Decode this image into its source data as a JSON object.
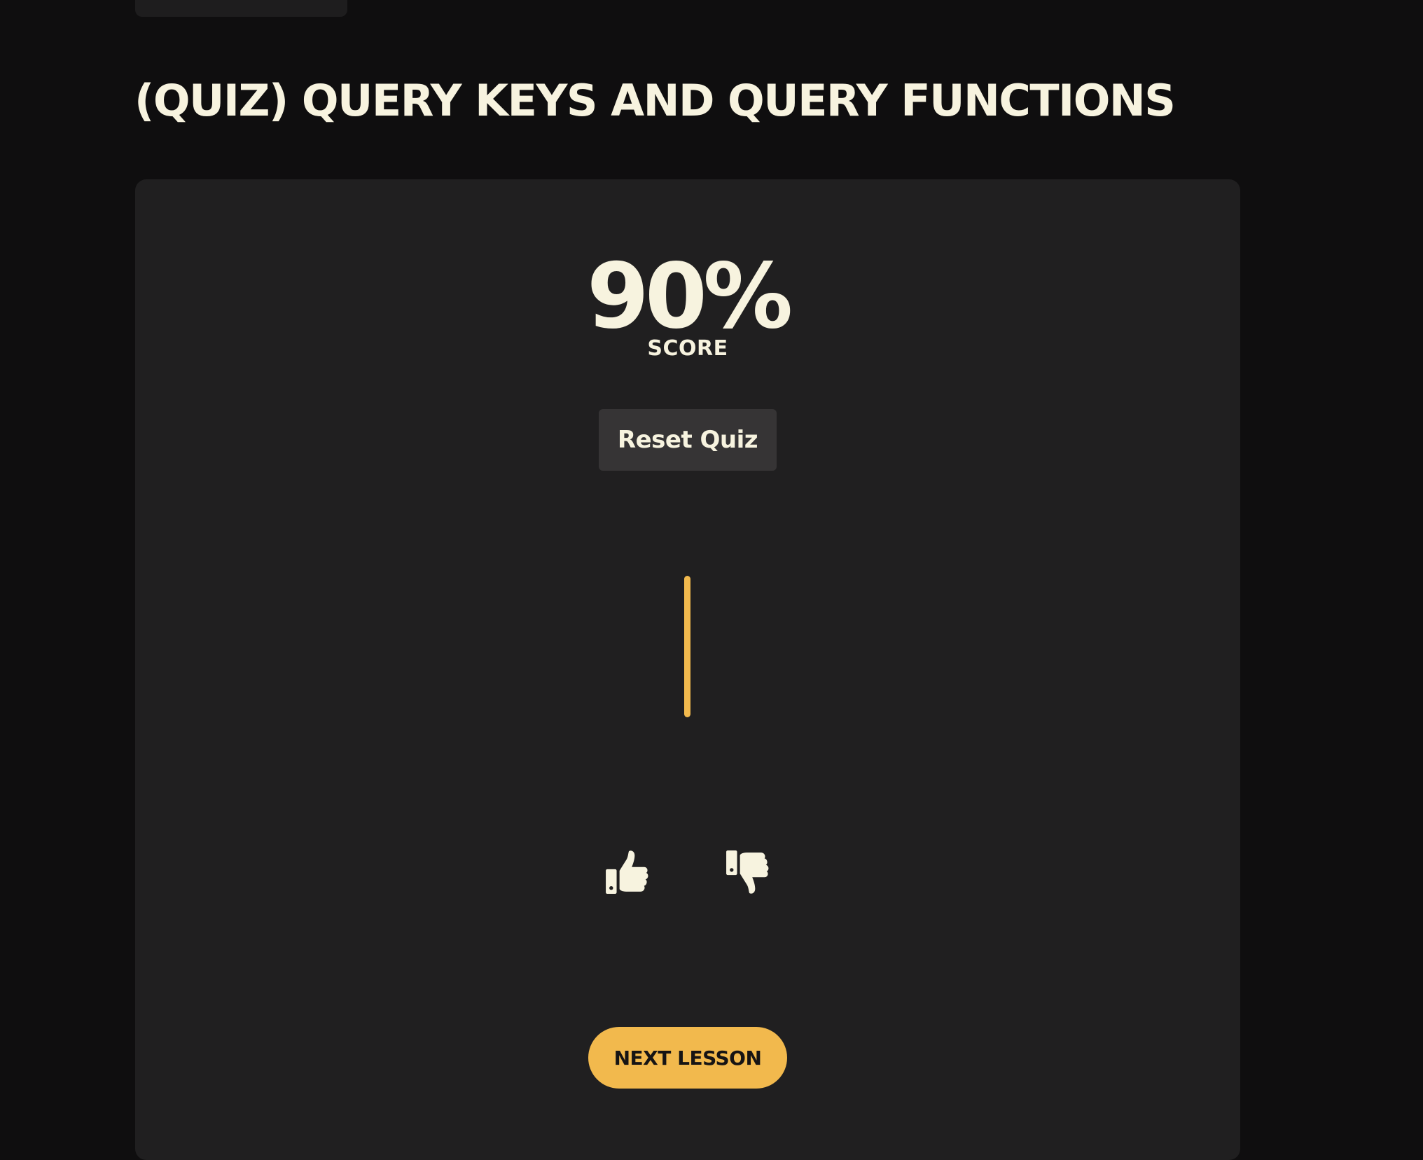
{
  "page": {
    "title": "(QUIZ) QUERY KEYS AND QUERY FUNCTIONS"
  },
  "quiz": {
    "score_value": "90%",
    "score_label": "SCORE",
    "reset_label": "Reset Quiz",
    "next_label": "NEXT LESSON"
  },
  "feedback": {
    "icons": [
      "thumbs-up-icon",
      "thumbs-down-icon"
    ]
  },
  "colors": {
    "background": "#0f0e0f",
    "card": "#201f20",
    "text": "#f7f3df",
    "accent": "#f2b94d",
    "reset_button": "#363435"
  }
}
